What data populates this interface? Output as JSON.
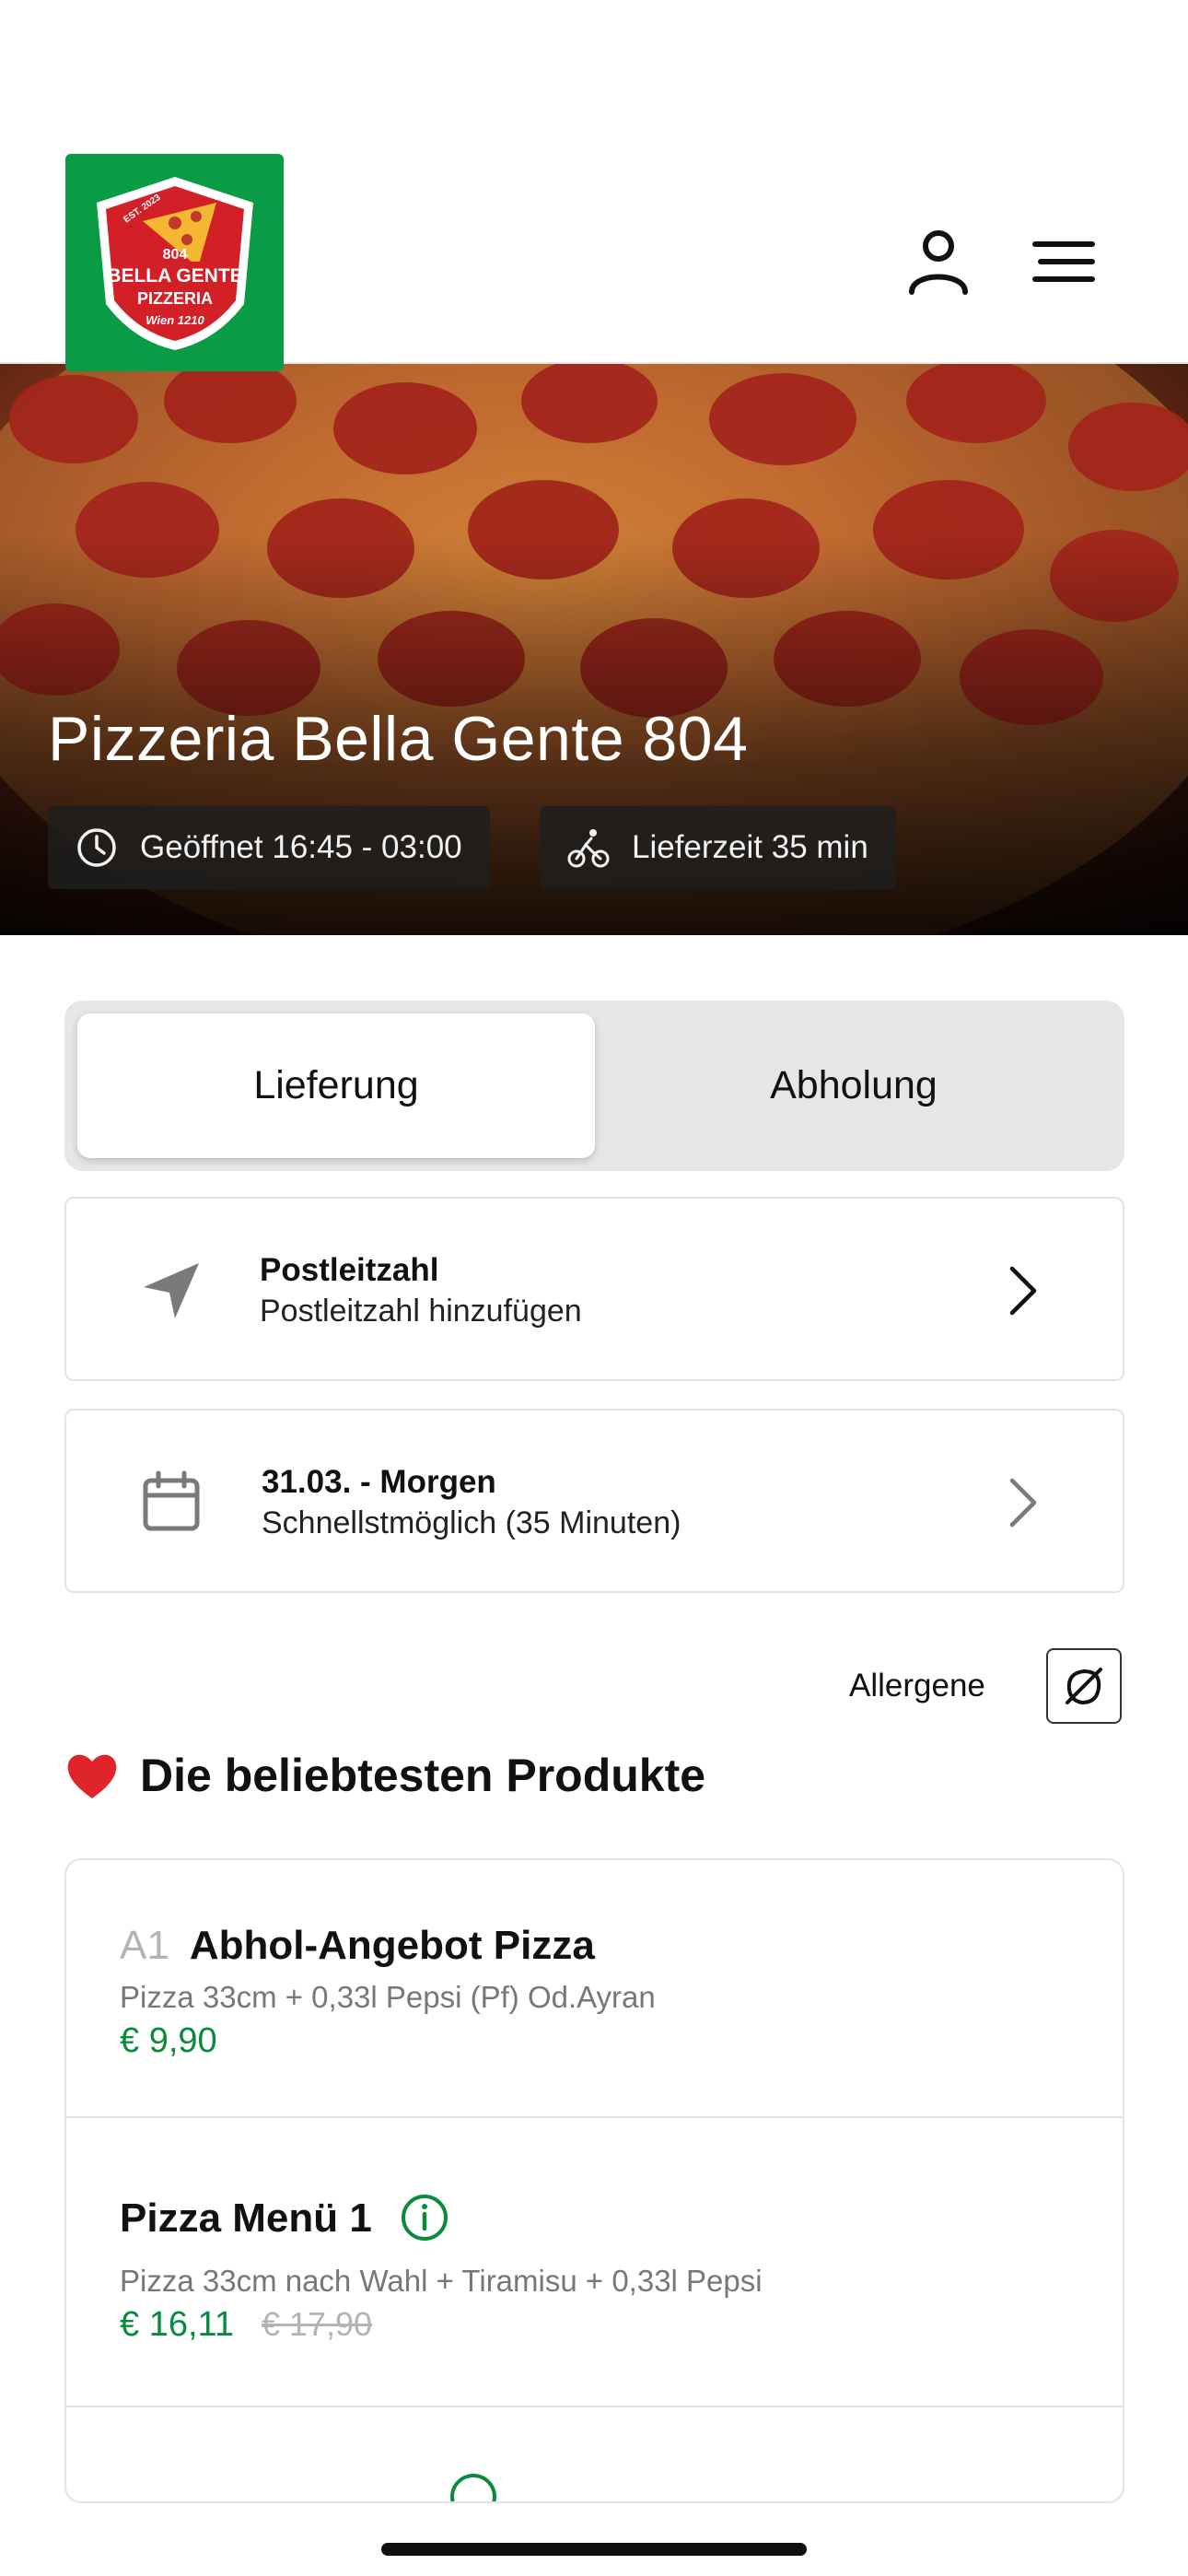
{
  "header": {
    "logo": {
      "line1": "BELLA GENTE",
      "line2": "PIZZERIA",
      "line3": "Wien 1210",
      "badge": "804",
      "est": "EST. 2023"
    },
    "account_icon": "user-icon",
    "menu_icon": "hamburger-menu-icon"
  },
  "hero": {
    "title": "Pizzeria Bella Gente 804",
    "hours": "Geöffnet 16:45 - 03:00",
    "delivery_time": "Lieferzeit 35 min"
  },
  "order_mode": {
    "options": [
      "Lieferung",
      "Abholung"
    ],
    "selected": "Lieferung"
  },
  "postcode_card": {
    "title": "Postleitzahl",
    "subtitle": "Postleitzahl hinzufügen",
    "icon": "location-arrow-icon"
  },
  "time_card": {
    "title": "31.03. - Morgen",
    "subtitle": "Schnellstmöglich (35 Minuten)",
    "icon": "calendar-icon"
  },
  "allergens": {
    "label": "Allergene",
    "icon": "allergen-filter-icon"
  },
  "popular": {
    "title": "Die beliebtesten Produkte",
    "products": [
      {
        "code": "A1",
        "name": "Abhol-Angebot Pizza",
        "description": "Pizza 33cm + 0,33l Pepsi (Pf) Od.Ayran",
        "price": "€ 9,90",
        "old_price": ""
      },
      {
        "code": "",
        "name": "Pizza Menü 1",
        "description": "Pizza 33cm nach Wahl + Tiramisu + 0,33l Pepsi",
        "price": "€ 16,11",
        "old_price": "€ 17,90"
      }
    ]
  },
  "colors": {
    "brand_green": "#0a9b45",
    "price_green": "#0a8a3c",
    "logo_red": "#d32027"
  }
}
